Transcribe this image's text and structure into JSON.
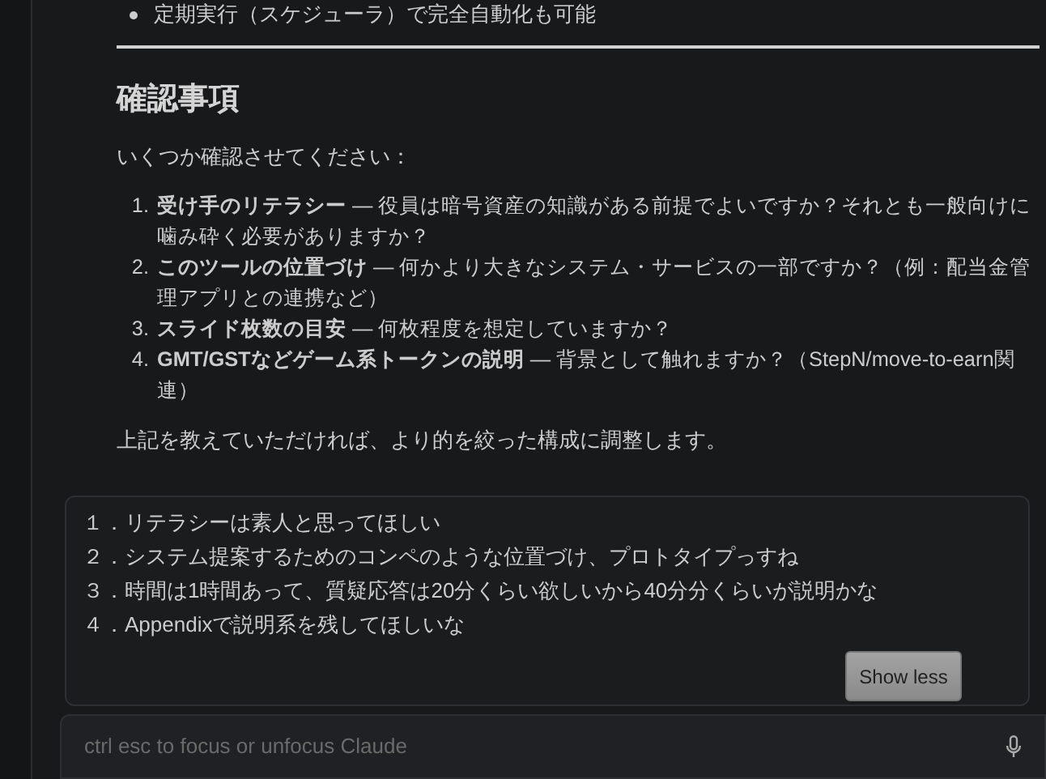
{
  "response": {
    "bullets": [
      "定期実行（スケジューラ）で完全自動化も可能"
    ],
    "heading": "確認事項",
    "intro": "いくつか確認させてください：",
    "questions": [
      {
        "number": "1.",
        "text": "**受け手のリテラシー** — 役員は暗号資産の知識がある前提でよいですか？それとも一般向けに噛み砕く必要がありますか？"
      },
      {
        "number": "2.",
        "text": "**このツールの位置づけ** — 何かより大きなシステム・サービスの一部ですか？（例：配当金管理アプリとの連携など）"
      },
      {
        "number": "3.",
        "text": "**スライド枚数の目安** — 何枚程度を想定していますか？"
      },
      {
        "number": "4.",
        "text": "**GMT/GSTなどゲーム系トークンの説明** — 背景として触れますか？（StepN/move-to-earn関連）"
      }
    ],
    "closing": "上記を教えていただければ、より的を絞った構成に調整します。"
  },
  "user_message": {
    "lines": [
      "１．リテラシーは素人と思ってほしい",
      "２．システム提案するためのコンペのような位置づけ、プロトタイプっすね",
      "３．時間は1時間あって、質疑応答は20分くらい欲しいから40分分くらいが説明かな",
      "４．Appendixで説明系を残してほしいな"
    ],
    "button": "Show less"
  },
  "input": {
    "placeholder": "ctrl esc to focus or unfocus Claude"
  }
}
